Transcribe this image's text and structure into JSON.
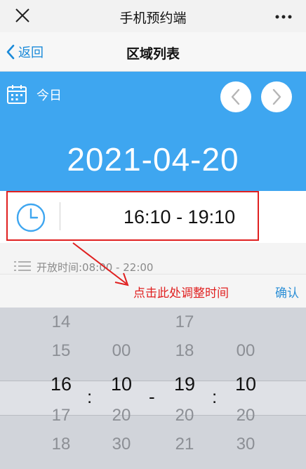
{
  "app": {
    "title": "手机预约端"
  },
  "nav": {
    "back_label": "返回",
    "title": "区域列表"
  },
  "date_header": {
    "today_label": "今日",
    "date": "2021-04-20"
  },
  "time_selection": {
    "range": "16:10 - 19:10"
  },
  "opening": {
    "label": "开放时间:08:00 - 22:00"
  },
  "toolbar": {
    "hint": "点击此处调整时间",
    "confirm_label": "确认"
  },
  "picker": {
    "separator_colon": ":",
    "separator_dash": "-",
    "start_hour": [
      "14",
      "15",
      "16",
      "17",
      "18"
    ],
    "start_minute": [
      "",
      "00",
      "10",
      "20",
      "30"
    ],
    "end_hour": [
      "17",
      "18",
      "19",
      "20",
      "21"
    ],
    "end_minute": [
      "",
      "00",
      "10",
      "20",
      "30"
    ]
  },
  "colors": {
    "accent_blue": "#3ea6f0",
    "annotation_red": "#e02020",
    "link_blue": "#2c8fd6"
  }
}
